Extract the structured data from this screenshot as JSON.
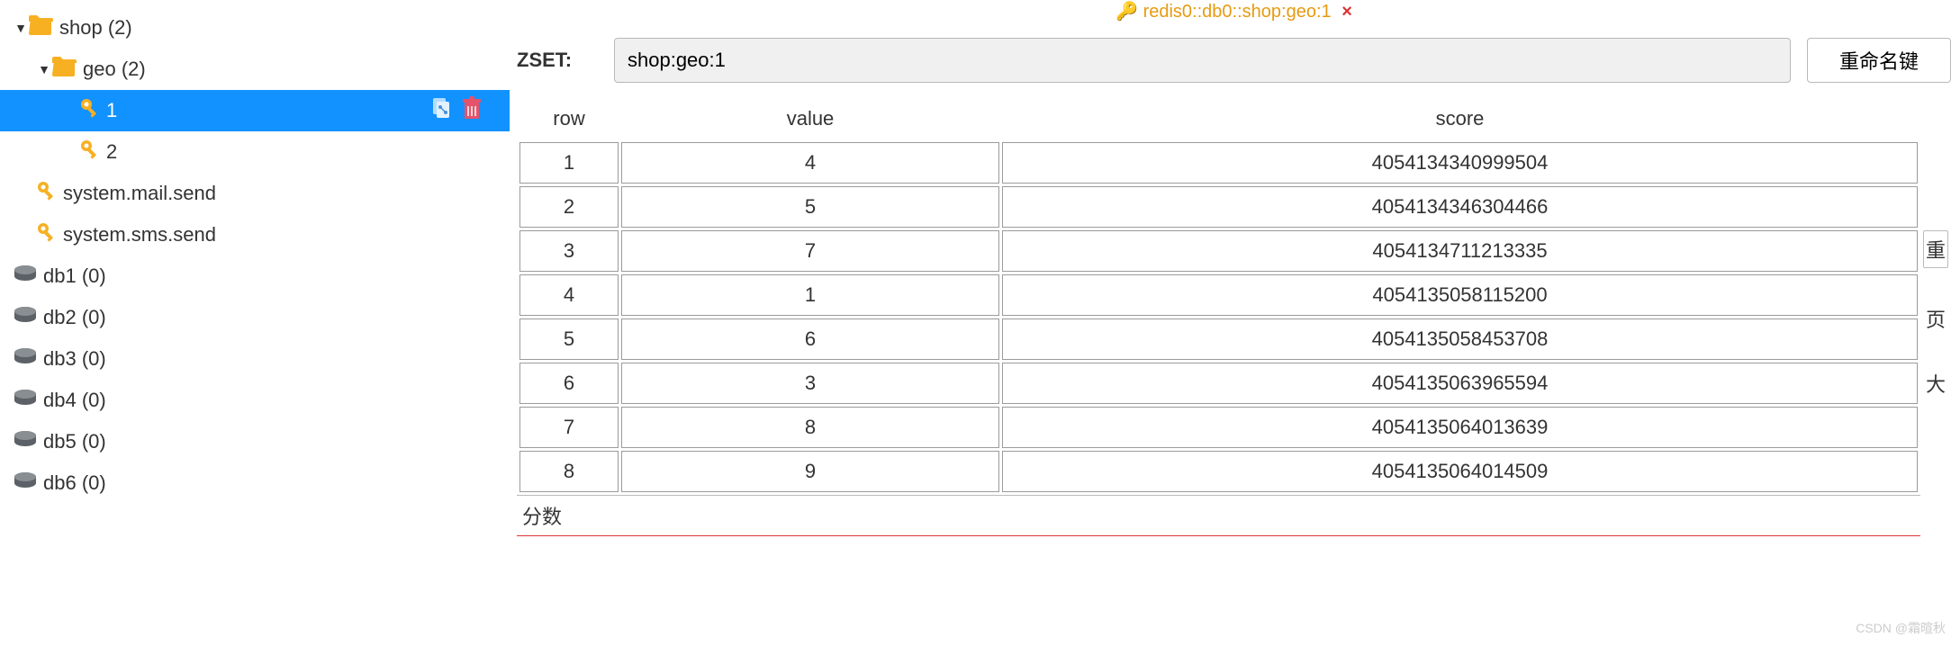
{
  "tree": {
    "shop": {
      "label": "shop (2)",
      "expanded": true
    },
    "geo": {
      "label": "geo (2)",
      "expanded": true
    },
    "key1": {
      "label": "1"
    },
    "key2": {
      "label": "2"
    },
    "mail": {
      "label": "system.mail.send"
    },
    "sms": {
      "label": "system.sms.send"
    },
    "db1": {
      "label": "db1  (0)"
    },
    "db2": {
      "label": "db2  (0)"
    },
    "db3": {
      "label": "db3  (0)"
    },
    "db4": {
      "label": "db4  (0)"
    },
    "db5": {
      "label": "db5  (0)"
    },
    "db6": {
      "label": "db6  (0)"
    }
  },
  "tab": {
    "title": "redis0::db0::shop:geo:1",
    "close": "×"
  },
  "key_panel": {
    "type_label": "ZSET:",
    "key_value": "shop:geo:1",
    "rename_label": "重命名键"
  },
  "table": {
    "headers": {
      "row": "row",
      "value": "value",
      "score": "score"
    },
    "rows": [
      {
        "row": "1",
        "value": "4",
        "score": "4054134340999504"
      },
      {
        "row": "2",
        "value": "5",
        "score": "4054134346304466"
      },
      {
        "row": "3",
        "value": "7",
        "score": "4054134711213335"
      },
      {
        "row": "4",
        "value": "1",
        "score": "4054135058115200"
      },
      {
        "row": "5",
        "value": "6",
        "score": "4054135058453708"
      },
      {
        "row": "6",
        "value": "3",
        "score": "4054135063965594"
      },
      {
        "row": "7",
        "value": "8",
        "score": "4054135064013639"
      },
      {
        "row": "8",
        "value": "9",
        "score": "4054135064014509"
      }
    ],
    "footer_label": "分数"
  },
  "side": {
    "btn1": "重",
    "label_page": "页",
    "label_size": "大"
  },
  "watermark": "CSDN @霜暄秋"
}
